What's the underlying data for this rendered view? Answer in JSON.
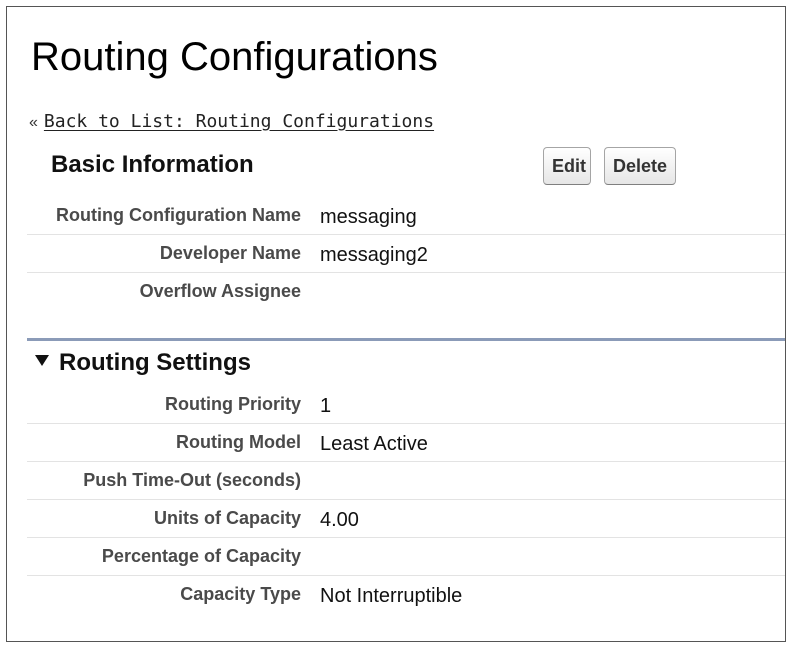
{
  "page": {
    "title": "Routing Configurations"
  },
  "back_link": {
    "prefix": "«",
    "label": "Back to List: Routing Configurations"
  },
  "basic_information": {
    "title": "Basic Information",
    "edit_label": "Edit",
    "delete_label": "Delete",
    "fields": [
      {
        "label": "Routing Configuration Name",
        "value": "messaging"
      },
      {
        "label": "Developer Name",
        "value": "messaging2"
      },
      {
        "label": "Overflow Assignee",
        "value": ""
      }
    ]
  },
  "routing_settings": {
    "title": "Routing Settings",
    "collapse_icon": "triangle-down-icon",
    "fields": [
      {
        "label": "Routing Priority",
        "value": "1"
      },
      {
        "label": "Routing Model",
        "value": "Least Active"
      },
      {
        "label": "Push Time-Out (seconds)",
        "value": ""
      },
      {
        "label": "Units of Capacity",
        "value": "4.00"
      },
      {
        "label": "Percentage of Capacity",
        "value": ""
      },
      {
        "label": "Capacity Type",
        "value": "Not Interruptible"
      }
    ]
  },
  "colors": {
    "section_divider": "#8b9bb8",
    "row_border": "#e3e3e3",
    "label_text": "#4a4a4a"
  }
}
